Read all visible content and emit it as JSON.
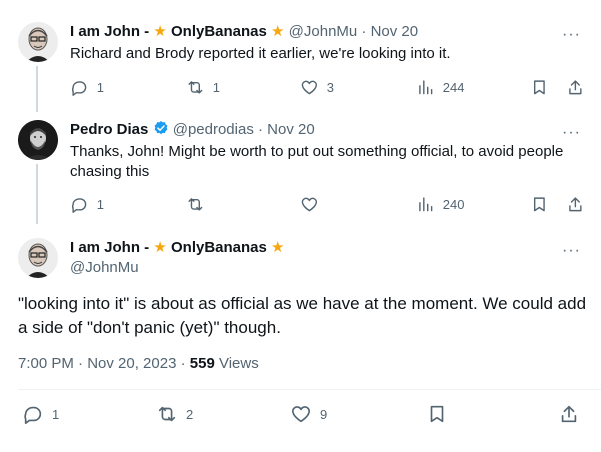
{
  "tweets": [
    {
      "name": "I am John -",
      "brand": "OnlyBananas",
      "handle": "@JohnMu",
      "sep": "·",
      "date": "Nov 20",
      "text": "Richard and Brody reported it earlier, we're looking into it.",
      "replies": "1",
      "retweets": "1",
      "likes": "3",
      "views": "244"
    },
    {
      "name": "Pedro Dias",
      "handle": "@pedrodias",
      "sep": "·",
      "date": "Nov 20",
      "text": "Thanks, John! Might be worth to put out something official, to avoid people chasing this",
      "replies": "1",
      "retweets": "",
      "likes": "",
      "views": "240"
    }
  ],
  "main": {
    "name": "I am John -",
    "brand": "OnlyBananas",
    "handle": "@JohnMu",
    "text": "\"looking into it\" is about as official as we have at the moment. We could add a side of \"don't panic (yet)\" though.",
    "time": "7:00 PM · Nov 20, 2023 · ",
    "views_count": "559",
    "views_label": " Views",
    "replies": "1",
    "retweets": "2",
    "likes": "9"
  },
  "colors": {
    "verified": "#1d9bf0",
    "star": "#f7a70b",
    "muted": "#536471",
    "text": "#0f1419"
  },
  "icons": [
    "reply-icon",
    "retweet-icon",
    "like-icon",
    "views-icon",
    "bookmark-icon",
    "share-icon",
    "more-icon",
    "star-icon",
    "verified-icon"
  ]
}
